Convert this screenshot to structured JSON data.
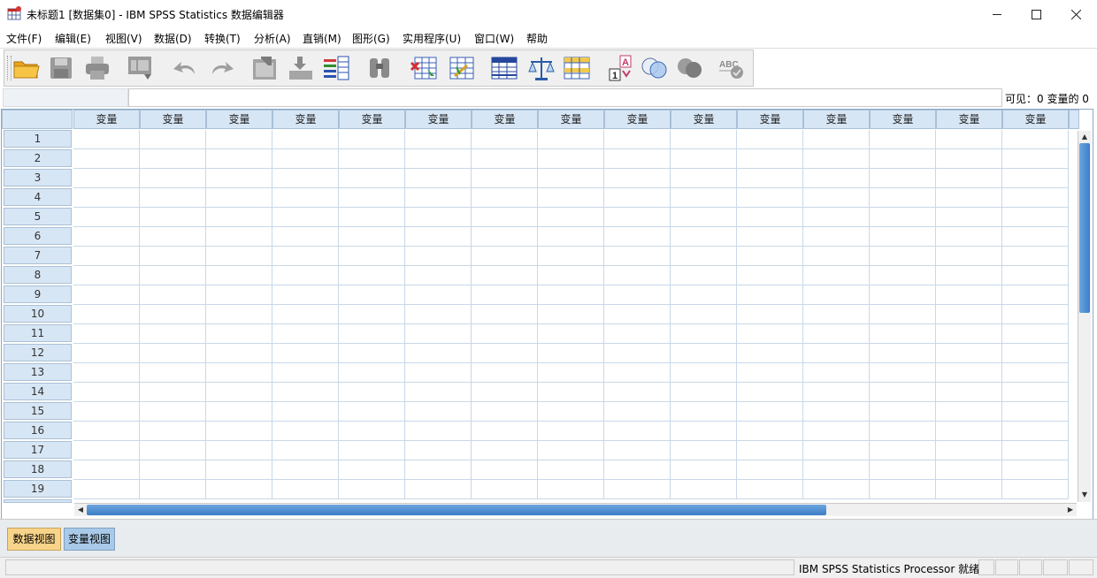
{
  "window": {
    "title": "未标题1 [数据集0] - IBM SPSS Statistics 数据编辑器",
    "minimize": "—",
    "maximize": "☐",
    "close": "✕"
  },
  "menu": [
    {
      "label": "文件(F)"
    },
    {
      "label": "编辑(E)"
    },
    {
      "label": "视图(V)"
    },
    {
      "label": "数据(D)"
    },
    {
      "label": "转换(T)"
    },
    {
      "label": "分析(A)"
    },
    {
      "label": "直销(M)"
    },
    {
      "label": "图形(G)"
    },
    {
      "label": "实用程序(U)"
    },
    {
      "label": "窗口(W)"
    },
    {
      "label": "帮助"
    }
  ],
  "toolbar": {
    "buttons": [
      {
        "icon": "open-folder-icon"
      },
      {
        "icon": "save-icon"
      },
      {
        "icon": "print-icon"
      },
      {
        "icon": "dialog-recall-icon"
      },
      {
        "icon": "undo-icon"
      },
      {
        "icon": "redo-icon"
      },
      {
        "icon": "goto-case-icon"
      },
      {
        "icon": "goto-variable-icon"
      },
      {
        "icon": "variables-icon"
      },
      {
        "icon": "find-icon"
      },
      {
        "icon": "insert-cases-icon"
      },
      {
        "icon": "insert-variable-icon"
      },
      {
        "icon": "split-file-icon"
      },
      {
        "icon": "weight-cases-icon"
      },
      {
        "icon": "select-cases-icon"
      },
      {
        "icon": "value-labels-icon"
      },
      {
        "icon": "use-variable-sets-icon"
      },
      {
        "icon": "show-all-variables-icon"
      },
      {
        "icon": "spell-check-icon"
      }
    ]
  },
  "cellbar": {
    "visible": "可见：0 变量的 0"
  },
  "grid": {
    "column_header": "变量",
    "rows": [
      "1",
      "2",
      "3",
      "4",
      "5",
      "6",
      "7",
      "8",
      "9",
      "10",
      "11",
      "12",
      "13",
      "14",
      "15",
      "16",
      "17",
      "18",
      "19"
    ]
  },
  "tabs": {
    "data_view": "数据视图",
    "variable_view": "变量视图"
  },
  "status": {
    "processor": "IBM SPSS Statistics Processor 就绪"
  },
  "colors": {
    "header_bg": "#d7e6f5",
    "scroll_thumb": "#4a8fd4",
    "active_tab": "#f7d48a",
    "inactive_tab": "#a9c9e8"
  }
}
